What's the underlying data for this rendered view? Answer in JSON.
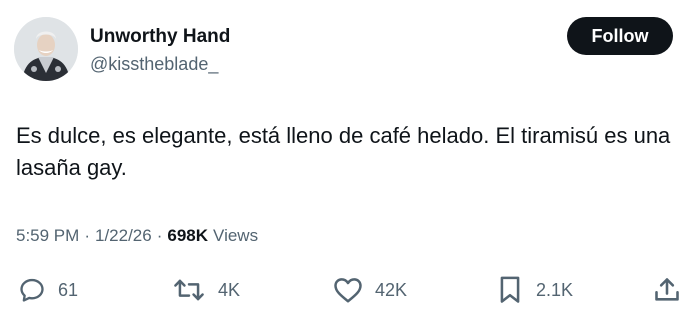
{
  "author": {
    "display_name": "Unworthy Hand",
    "handle": "@kisstheblade_"
  },
  "follow_label": "Follow",
  "tweet": {
    "text": "Es dulce, es elegante, está lleno de café helado. El tiramisú es una lasaña gay."
  },
  "meta": {
    "time": "5:59 PM",
    "separator": "·",
    "date": "1/22/26",
    "views_count": "698K",
    "views_label": "Views"
  },
  "actions": {
    "replies": "61",
    "reposts": "4K",
    "likes": "42K",
    "bookmarks": "2.1K"
  },
  "icons": {
    "reply": "reply-icon",
    "repost": "repost-icon",
    "like": "heart-icon",
    "bookmark": "bookmark-icon",
    "share": "share-icon"
  },
  "colors": {
    "text": "#0f1419",
    "secondary": "#536471",
    "button_bg": "#0f1419"
  }
}
